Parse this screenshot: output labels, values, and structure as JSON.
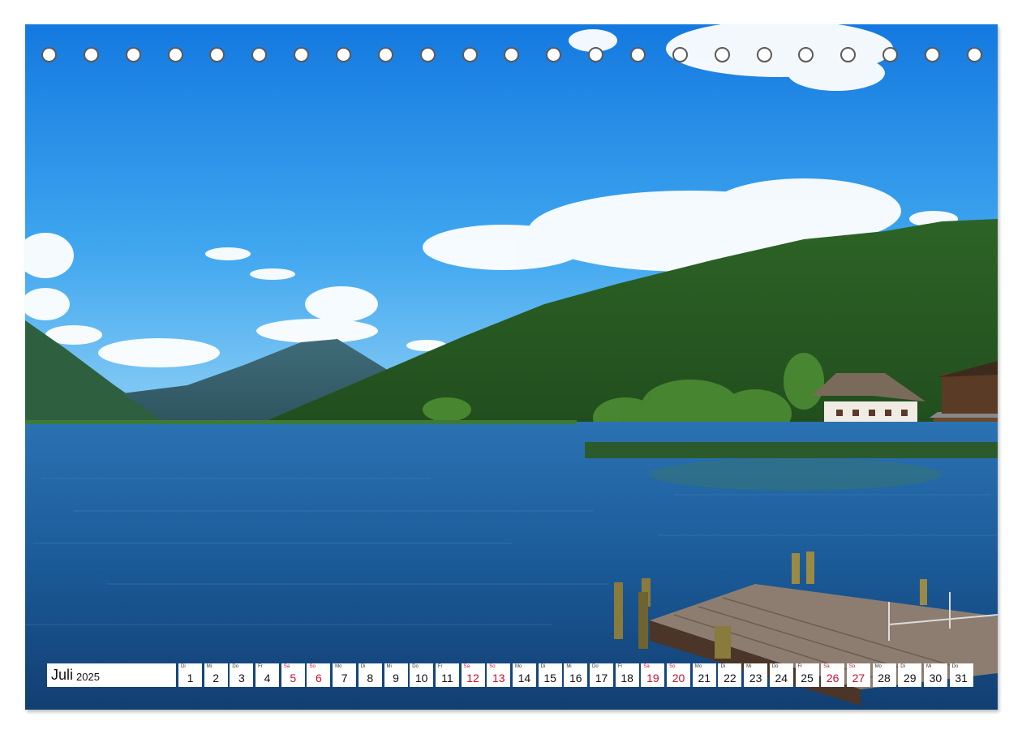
{
  "calendar": {
    "month": "Juli",
    "year": "2025",
    "weekend_color": "#c8102e",
    "days": [
      {
        "wd": "Di",
        "n": "1",
        "we": false
      },
      {
        "wd": "Mi",
        "n": "2",
        "we": false
      },
      {
        "wd": "Do",
        "n": "3",
        "we": false
      },
      {
        "wd": "Fr",
        "n": "4",
        "we": false
      },
      {
        "wd": "Sa",
        "n": "5",
        "we": true
      },
      {
        "wd": "So",
        "n": "6",
        "we": true
      },
      {
        "wd": "Mo",
        "n": "7",
        "we": false
      },
      {
        "wd": "Di",
        "n": "8",
        "we": false
      },
      {
        "wd": "Mi",
        "n": "9",
        "we": false
      },
      {
        "wd": "Do",
        "n": "10",
        "we": false
      },
      {
        "wd": "Fr",
        "n": "11",
        "we": false
      },
      {
        "wd": "Sa",
        "n": "12",
        "we": true
      },
      {
        "wd": "So",
        "n": "13",
        "we": true
      },
      {
        "wd": "Mo",
        "n": "14",
        "we": false
      },
      {
        "wd": "Di",
        "n": "15",
        "we": false
      },
      {
        "wd": "Mi",
        "n": "16",
        "we": false
      },
      {
        "wd": "Do",
        "n": "17",
        "we": false
      },
      {
        "wd": "Fr",
        "n": "18",
        "we": false
      },
      {
        "wd": "Sa",
        "n": "19",
        "we": true
      },
      {
        "wd": "So",
        "n": "20",
        "we": true
      },
      {
        "wd": "Mo",
        "n": "21",
        "we": false
      },
      {
        "wd": "Di",
        "n": "22",
        "we": false
      },
      {
        "wd": "Mi",
        "n": "23",
        "we": false
      },
      {
        "wd": "Do",
        "n": "24",
        "we": false
      },
      {
        "wd": "Fr",
        "n": "25",
        "we": false
      },
      {
        "wd": "Sa",
        "n": "26",
        "we": true
      },
      {
        "wd": "So",
        "n": "27",
        "we": true
      },
      {
        "wd": "Mo",
        "n": "28",
        "we": false
      },
      {
        "wd": "Di",
        "n": "29",
        "we": false
      },
      {
        "wd": "Mi",
        "n": "30",
        "we": false
      },
      {
        "wd": "Do",
        "n": "31",
        "we": false
      }
    ]
  },
  "binding_hole_count": 23,
  "photo": {
    "sky_top": "#1a86e8",
    "sky_bottom": "#6fc2f5",
    "lake_color": "#1d5b96",
    "forest_color": "#2f6a2a"
  }
}
